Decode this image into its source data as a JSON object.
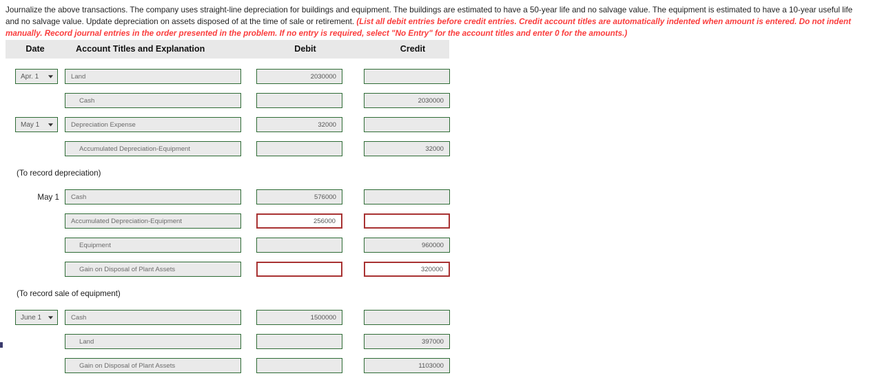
{
  "instructions": {
    "normal_part_1": "Journalize the above transactions. The company uses straight-line depreciation for buildings and equipment. The buildings are estimated to have a 50-year life and no salvage value. The equipment is estimated to have a 10-year useful life and no salvage value. Update depreciation on assets disposed of at the time of sale or retirement. ",
    "note_part": "(List all debit entries before credit entries. Credit account titles are automatically indented when amount is entered. Do not indent manually. Record journal entries in the order presented in the problem. If no entry is required, select \"No Entry\" for the account titles and enter 0 for the amounts.)"
  },
  "table": {
    "headers": {
      "date": "Date",
      "account": "Account Titles and Explanation",
      "debit": "Debit",
      "credit": "Credit"
    },
    "placeholders": {
      "account_title": "",
      "amount": ""
    },
    "rows": [
      {
        "kind": "entry",
        "date_type": "select",
        "date_value": "Apr. 1",
        "account": "Land",
        "indent": false,
        "debit": "2030000",
        "credit": "",
        "debit_error": false,
        "credit_error": false
      },
      {
        "kind": "entry",
        "date_type": "none",
        "date_value": "",
        "account": "Cash",
        "indent": true,
        "debit": "",
        "credit": "2030000",
        "debit_error": false,
        "credit_error": false
      },
      {
        "kind": "entry",
        "date_type": "select",
        "date_value": "May 1",
        "account": "Depreciation Expense",
        "indent": false,
        "debit": "32000",
        "credit": "",
        "debit_error": false,
        "credit_error": false
      },
      {
        "kind": "entry",
        "date_type": "none",
        "date_value": "",
        "account": "Accumulated Depreciation-Equipment",
        "indent": true,
        "debit": "",
        "credit": "32000",
        "debit_error": false,
        "credit_error": false
      },
      {
        "kind": "memo",
        "memo": "(To record depreciation)"
      },
      {
        "kind": "entry",
        "date_type": "text",
        "date_value": "May 1",
        "account": "Cash",
        "indent": false,
        "debit": "576000",
        "credit": "",
        "debit_error": false,
        "credit_error": false
      },
      {
        "kind": "entry",
        "date_type": "none",
        "date_value": "",
        "account": "Accumulated Depreciation-Equipment",
        "indent": false,
        "debit": "256000",
        "credit": "",
        "debit_error": true,
        "credit_error": true
      },
      {
        "kind": "entry",
        "date_type": "none",
        "date_value": "",
        "account": "Equipment",
        "indent": true,
        "debit": "",
        "credit": "960000",
        "debit_error": false,
        "credit_error": false
      },
      {
        "kind": "entry",
        "date_type": "none",
        "date_value": "",
        "account": "Gain on Disposal of Plant Assets",
        "indent": true,
        "debit": "",
        "credit": "320000",
        "debit_error": true,
        "credit_error": true
      },
      {
        "kind": "memo",
        "memo": "(To record sale of equipment)"
      },
      {
        "kind": "entry",
        "date_type": "select",
        "date_value": "June 1",
        "account": "Cash",
        "indent": false,
        "debit": "1500000",
        "credit": "",
        "debit_error": false,
        "credit_error": false
      },
      {
        "kind": "entry",
        "date_type": "none",
        "date_value": "",
        "account": "Land",
        "indent": true,
        "debit": "",
        "credit": "397000",
        "debit_error": false,
        "credit_error": false
      },
      {
        "kind": "entry",
        "date_type": "none",
        "date_value": "",
        "account": "Gain on Disposal of Plant Assets",
        "indent": true,
        "debit": "",
        "credit": "1103000",
        "debit_error": false,
        "credit_error": false
      }
    ]
  },
  "icons": {
    "chevron_down": "▼"
  },
  "colors": {
    "field_border": "#2e6b35",
    "field_background": "#eaeaea",
    "error_border": "#a83232",
    "header_background": "#e8e8e8",
    "note_text": "#fa3c3c"
  }
}
